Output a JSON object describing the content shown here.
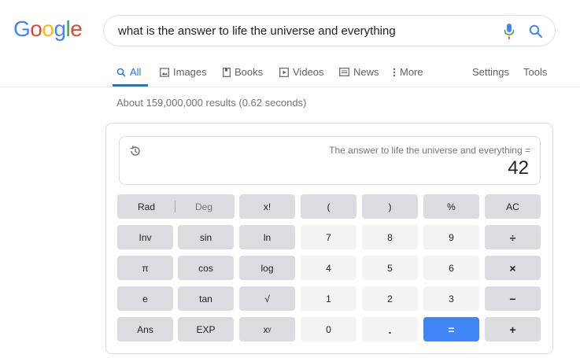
{
  "logo": {
    "letters": [
      "G",
      "o",
      "o",
      "g",
      "l",
      "e"
    ],
    "colors": [
      "#4285f4",
      "#ea4335",
      "#fbbc05",
      "#4285f4",
      "#34a853",
      "#ea4335"
    ]
  },
  "search": {
    "query": "what is the answer to life the universe and everything"
  },
  "tabs": [
    {
      "label": "All",
      "icon": "search-icon"
    },
    {
      "label": "Images",
      "icon": "image-icon"
    },
    {
      "label": "Books",
      "icon": "book-icon"
    },
    {
      "label": "Videos",
      "icon": "play-icon"
    },
    {
      "label": "News",
      "icon": "news-icon"
    },
    {
      "label": "More",
      "icon": "more-vert-icon"
    },
    {
      "label": "Settings"
    },
    {
      "label": "Tools"
    }
  ],
  "stats": "About 159,000,000 results (0.62 seconds)",
  "calculator": {
    "expression": "The answer to life the universe and everything =",
    "result": "42",
    "rad": "Rad",
    "deg": "Deg",
    "keys": {
      "fact": "x!",
      "lparen": "(",
      "rparen": ")",
      "percent": "%",
      "ac": "AC",
      "inv": "Inv",
      "sin": "sin",
      "ln": "ln",
      "k7": "7",
      "k8": "8",
      "k9": "9",
      "div": "÷",
      "pi": "π",
      "cos": "cos",
      "log": "log",
      "k4": "4",
      "k5": "5",
      "k6": "6",
      "mul": "×",
      "e": "e",
      "tan": "tan",
      "sqrt": "√",
      "k1": "1",
      "k2": "2",
      "k3": "3",
      "minus": "−",
      "ans": "Ans",
      "exp": "EXP",
      "pow_base": "x",
      "pow_exp": "y",
      "k0": "0",
      "dot": ".",
      "eq": "=",
      "plus": "+"
    }
  },
  "colors": {
    "accent": "#1a73e8",
    "equals": "#4285f4"
  }
}
